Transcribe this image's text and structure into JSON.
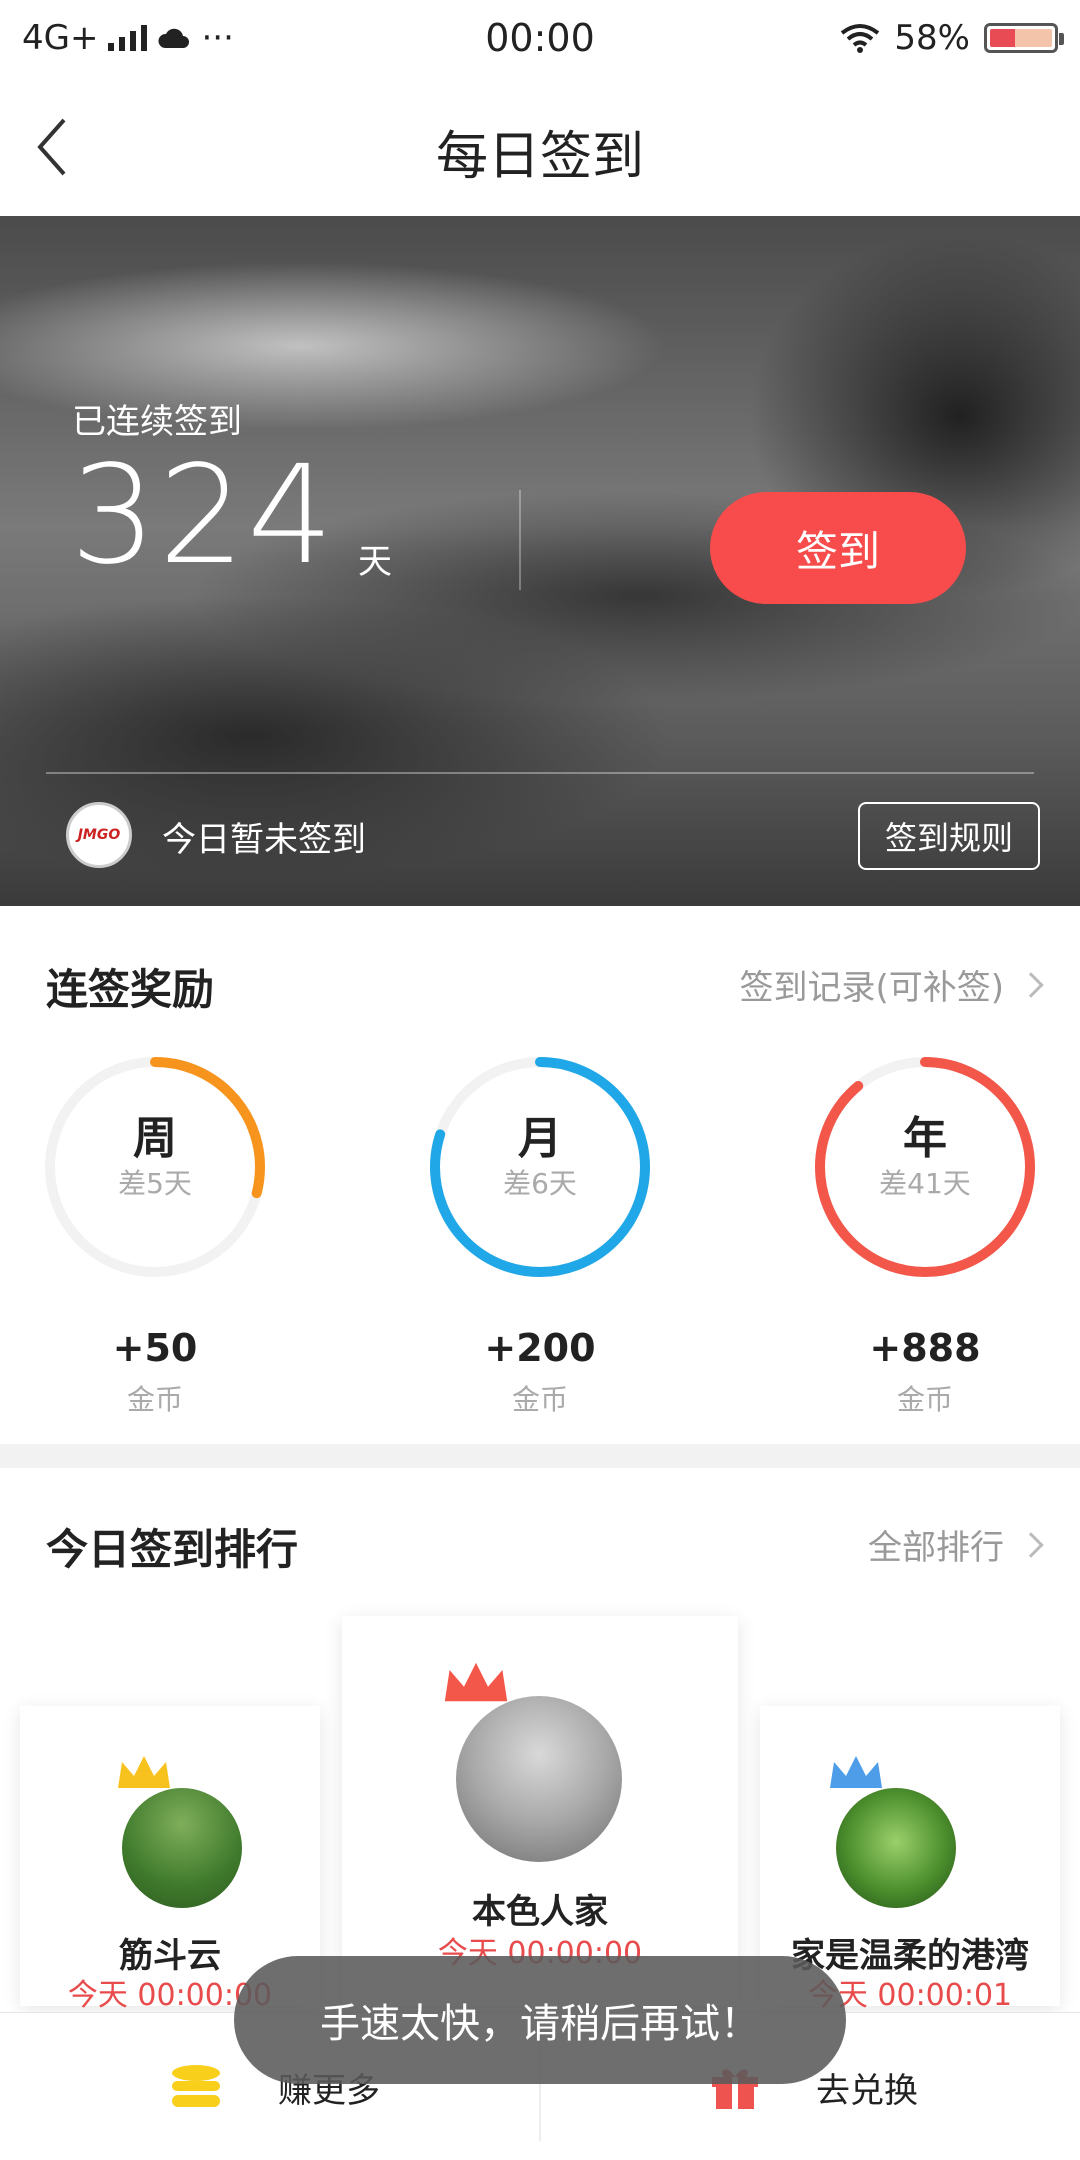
{
  "status_bar": {
    "network": "4G+",
    "time": "00:00",
    "battery": "58%",
    "dots": "···"
  },
  "nav": {
    "title": "每日签到"
  },
  "hero": {
    "label": "已连续签到",
    "days": "324",
    "unit": "天",
    "sign_button": "签到",
    "status_text": "今日暂未签到",
    "rules_button": "签到规则",
    "logo_text": "JMGO"
  },
  "rewards": {
    "title": "连签奖励",
    "link": "签到记录(可补签)",
    "items": [
      {
        "name": "周",
        "remaining": "差5天",
        "amount": "+50",
        "unit": "金币",
        "color": "#f7941d",
        "progress": 0.29
      },
      {
        "name": "月",
        "remaining": "差6天",
        "amount": "+200",
        "unit": "金币",
        "color": "#1fa7e8",
        "progress": 0.8
      },
      {
        "name": "年",
        "remaining": "差41天",
        "amount": "+888",
        "unit": "金币",
        "color": "#f2574a",
        "progress": 0.89
      }
    ]
  },
  "ranking": {
    "title": "今日签到排行",
    "link": "全部排行",
    "entries": [
      {
        "name": "本色人家",
        "time": "今天 00:00:00",
        "crown_color": "#f2574a"
      },
      {
        "name": "筋斗云",
        "time": "今天 00:00:00",
        "crown_color": "#f7c21d"
      },
      {
        "name": "家是温柔的港湾",
        "time": "今天 00:00:01",
        "crown_color": "#4d9de8"
      }
    ]
  },
  "bottom_bar": {
    "earn_more": "赚更多",
    "redeem": "去兑换"
  },
  "toast": {
    "message": "手速太快，请稍后再试！"
  },
  "colors": {
    "accent_red": "#f84b4b",
    "time_red": "#e84b4b"
  }
}
